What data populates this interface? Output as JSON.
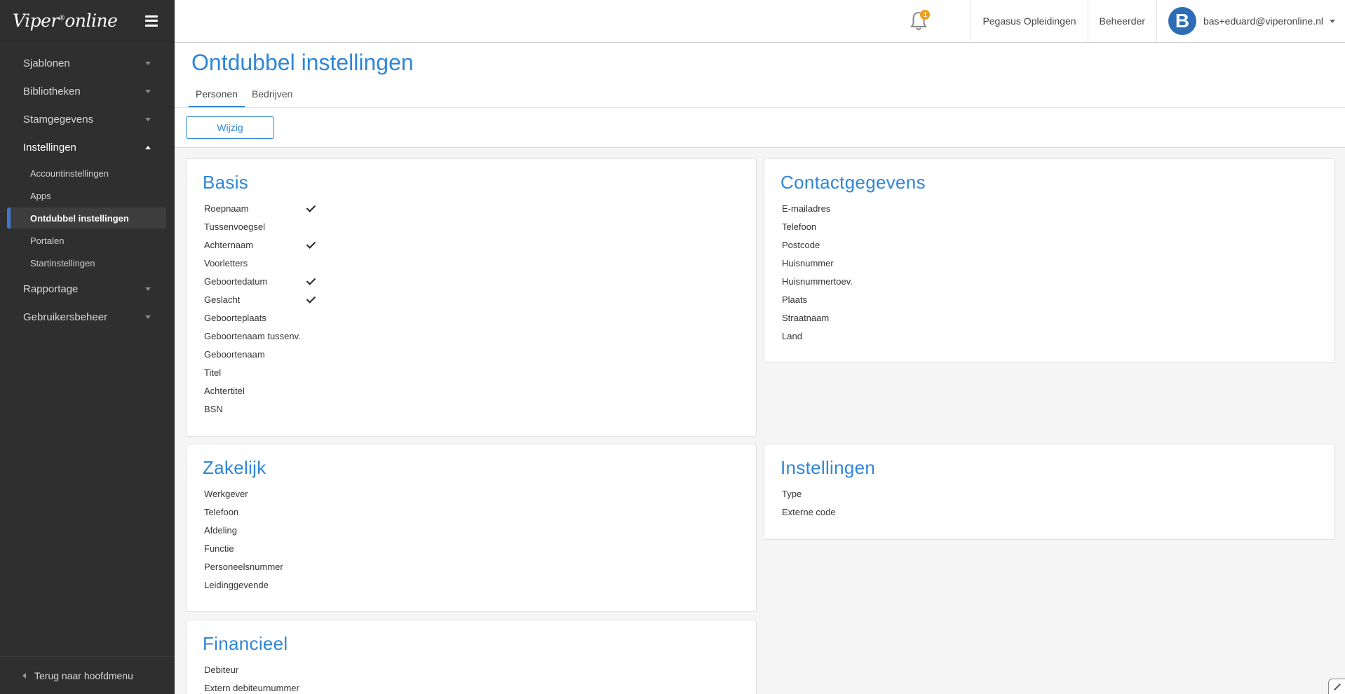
{
  "brand": {
    "name": "Viper",
    "mark": "®",
    "suffix": "online"
  },
  "sidebar": {
    "items": [
      {
        "label": "Sjablonen"
      },
      {
        "label": "Bibliotheken"
      },
      {
        "label": "Stamgegevens"
      },
      {
        "label": "Instellingen"
      },
      {
        "label": "Rapportage"
      },
      {
        "label": "Gebruikersbeheer"
      }
    ],
    "subitems": [
      {
        "label": "Accountinstellingen"
      },
      {
        "label": "Apps"
      },
      {
        "label": "Ontdubbel instellingen"
      },
      {
        "label": "Portalen"
      },
      {
        "label": "Startinstellingen"
      }
    ],
    "back_label": "Terug naar hoofdmenu"
  },
  "topbar": {
    "notification_count": "1",
    "org": "Pegasus Opleidingen",
    "role": "Beheerder",
    "avatar_letter": "B",
    "user_email": "bas+eduard@viperonline.nl"
  },
  "page": {
    "title": "Ontdubbel instellingen",
    "tabs": [
      {
        "label": "Personen"
      },
      {
        "label": "Bedrijven"
      }
    ],
    "edit_label": "Wijzig"
  },
  "sections": {
    "basis": {
      "title": "Basis",
      "fields": [
        {
          "label": "Roepnaam",
          "checked": true
        },
        {
          "label": "Tussenvoegsel",
          "checked": false
        },
        {
          "label": "Achternaam",
          "checked": true
        },
        {
          "label": "Voorletters",
          "checked": false
        },
        {
          "label": "Geboortedatum",
          "checked": true
        },
        {
          "label": "Geslacht",
          "checked": true
        },
        {
          "label": "Geboorteplaats",
          "checked": false
        },
        {
          "label": "Geboortenaam tussenv.",
          "checked": false
        },
        {
          "label": "Geboortenaam",
          "checked": false
        },
        {
          "label": "Titel",
          "checked": false
        },
        {
          "label": "Achtertitel",
          "checked": false
        },
        {
          "label": "BSN",
          "checked": false
        }
      ]
    },
    "contact": {
      "title": "Contactgegevens",
      "fields": [
        {
          "label": "E-mailadres"
        },
        {
          "label": "Telefoon"
        },
        {
          "label": "Postcode"
        },
        {
          "label": "Huisnummer"
        },
        {
          "label": "Huisnummertoev."
        },
        {
          "label": "Plaats"
        },
        {
          "label": "Straatnaam"
        },
        {
          "label": "Land"
        }
      ]
    },
    "zakelijk": {
      "title": "Zakelijk",
      "fields": [
        {
          "label": "Werkgever"
        },
        {
          "label": "Telefoon"
        },
        {
          "label": "Afdeling"
        },
        {
          "label": "Functie"
        },
        {
          "label": "Personeelsnummer"
        },
        {
          "label": "Leidinggevende"
        }
      ]
    },
    "instellingen": {
      "title": "Instellingen",
      "fields": [
        {
          "label": "Type"
        },
        {
          "label": "Externe code"
        }
      ]
    },
    "financieel": {
      "title": "Financieel",
      "fields": [
        {
          "label": "Debiteur"
        },
        {
          "label": "Extern debiteurnummer"
        }
      ]
    }
  },
  "colors": {
    "accent": "#2f86d6",
    "sidebar_bg": "#2f2f2f",
    "badge": "#f39c12",
    "avatar": "#2d6db5"
  }
}
